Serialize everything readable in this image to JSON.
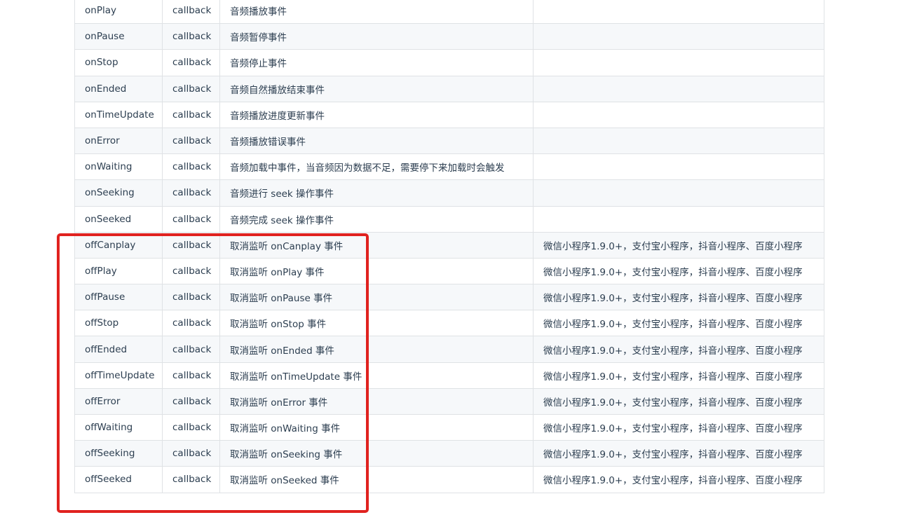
{
  "rows": [
    {
      "name": "onPlay",
      "type": "callback",
      "desc": "音频播放事件",
      "compat": ""
    },
    {
      "name": "onPause",
      "type": "callback",
      "desc": "音频暂停事件",
      "compat": ""
    },
    {
      "name": "onStop",
      "type": "callback",
      "desc": "音频停止事件",
      "compat": ""
    },
    {
      "name": "onEnded",
      "type": "callback",
      "desc": "音频自然播放结束事件",
      "compat": ""
    },
    {
      "name": "onTimeUpdate",
      "type": "callback",
      "desc": "音频播放进度更新事件",
      "compat": ""
    },
    {
      "name": "onError",
      "type": "callback",
      "desc": "音频播放错误事件",
      "compat": ""
    },
    {
      "name": "onWaiting",
      "type": "callback",
      "desc": "音频加载中事件，当音频因为数据不足，需要停下来加载时会触发",
      "compat": ""
    },
    {
      "name": "onSeeking",
      "type": "callback",
      "desc": "音频进行 seek 操作事件",
      "compat": ""
    },
    {
      "name": "onSeeked",
      "type": "callback",
      "desc": "音频完成 seek 操作事件",
      "compat": ""
    },
    {
      "name": "offCanplay",
      "type": "callback",
      "desc": "取消监听 onCanplay 事件",
      "compat": "微信小程序1.9.0+，支付宝小程序，抖音小程序、百度小程序"
    },
    {
      "name": "offPlay",
      "type": "callback",
      "desc": "取消监听 onPlay 事件",
      "compat": "微信小程序1.9.0+，支付宝小程序，抖音小程序、百度小程序"
    },
    {
      "name": "offPause",
      "type": "callback",
      "desc": "取消监听 onPause 事件",
      "compat": "微信小程序1.9.0+，支付宝小程序，抖音小程序、百度小程序"
    },
    {
      "name": "offStop",
      "type": "callback",
      "desc": "取消监听 onStop 事件",
      "compat": "微信小程序1.9.0+，支付宝小程序，抖音小程序、百度小程序"
    },
    {
      "name": "offEnded",
      "type": "callback",
      "desc": "取消监听 onEnded 事件",
      "compat": "微信小程序1.9.0+，支付宝小程序，抖音小程序、百度小程序"
    },
    {
      "name": "offTimeUpdate",
      "type": "callback",
      "desc": "取消监听 onTimeUpdate 事件",
      "compat": "微信小程序1.9.0+，支付宝小程序，抖音小程序、百度小程序"
    },
    {
      "name": "offError",
      "type": "callback",
      "desc": "取消监听 onError 事件",
      "compat": "微信小程序1.9.0+，支付宝小程序，抖音小程序、百度小程序"
    },
    {
      "name": "offWaiting",
      "type": "callback",
      "desc": "取消监听 onWaiting 事件",
      "compat": "微信小程序1.9.0+，支付宝小程序，抖音小程序、百度小程序"
    },
    {
      "name": "offSeeking",
      "type": "callback",
      "desc": "取消监听 onSeeking 事件",
      "compat": "微信小程序1.9.0+，支付宝小程序，抖音小程序、百度小程序"
    },
    {
      "name": "offSeeked",
      "type": "callback",
      "desc": "取消监听 onSeeked 事件",
      "compat": "微信小程序1.9.0+，支付宝小程序，抖音小程序、百度小程序"
    }
  ],
  "highlight_color": "#e0221f"
}
